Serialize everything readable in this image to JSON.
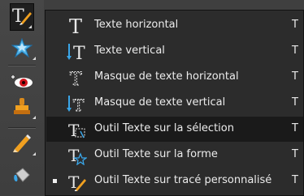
{
  "toolbar": {
    "tools": [
      {
        "name": "text-tool",
        "icon": "type-brush-icon",
        "selected": true
      },
      {
        "name": "shape-tool",
        "icon": "star-badge-icon"
      },
      {
        "name": "red-eye-tool",
        "icon": "red-eye-icon"
      },
      {
        "name": "stamp-tool",
        "icon": "clone-stamp-icon"
      },
      {
        "name": "pencil-tool",
        "icon": "pencil-icon"
      },
      {
        "name": "paint-bucket-tool",
        "icon": "paint-bucket-icon"
      }
    ]
  },
  "menu": {
    "items": [
      {
        "label": "Texte horizontal",
        "shortcut": "T",
        "icon": "horizontal-type-icon"
      },
      {
        "label": "Texte vertical",
        "shortcut": "T",
        "icon": "vertical-type-icon"
      },
      {
        "label": "Masque de texte horizontal",
        "shortcut": "T",
        "icon": "horizontal-type-mask-icon"
      },
      {
        "label": "Masque de texte vertical",
        "shortcut": "T",
        "icon": "vertical-type-mask-icon"
      },
      {
        "label": "Outil Texte sur la sélection",
        "shortcut": "T",
        "icon": "type-on-selection-icon",
        "highlighted": true
      },
      {
        "label": "Outil Texte sur la forme",
        "shortcut": "T",
        "icon": "type-on-shape-icon"
      },
      {
        "label": "Outil Texte sur tracé personnalisé",
        "shortcut": "T",
        "icon": "type-on-path-icon",
        "checked": true
      }
    ]
  },
  "colors": {
    "menu_bg": "#2c2c2c",
    "highlight": "#1a1a1a",
    "text": "#ececec",
    "accent_blue": "#3aa6e8",
    "accent_orange": "#f0a020"
  }
}
